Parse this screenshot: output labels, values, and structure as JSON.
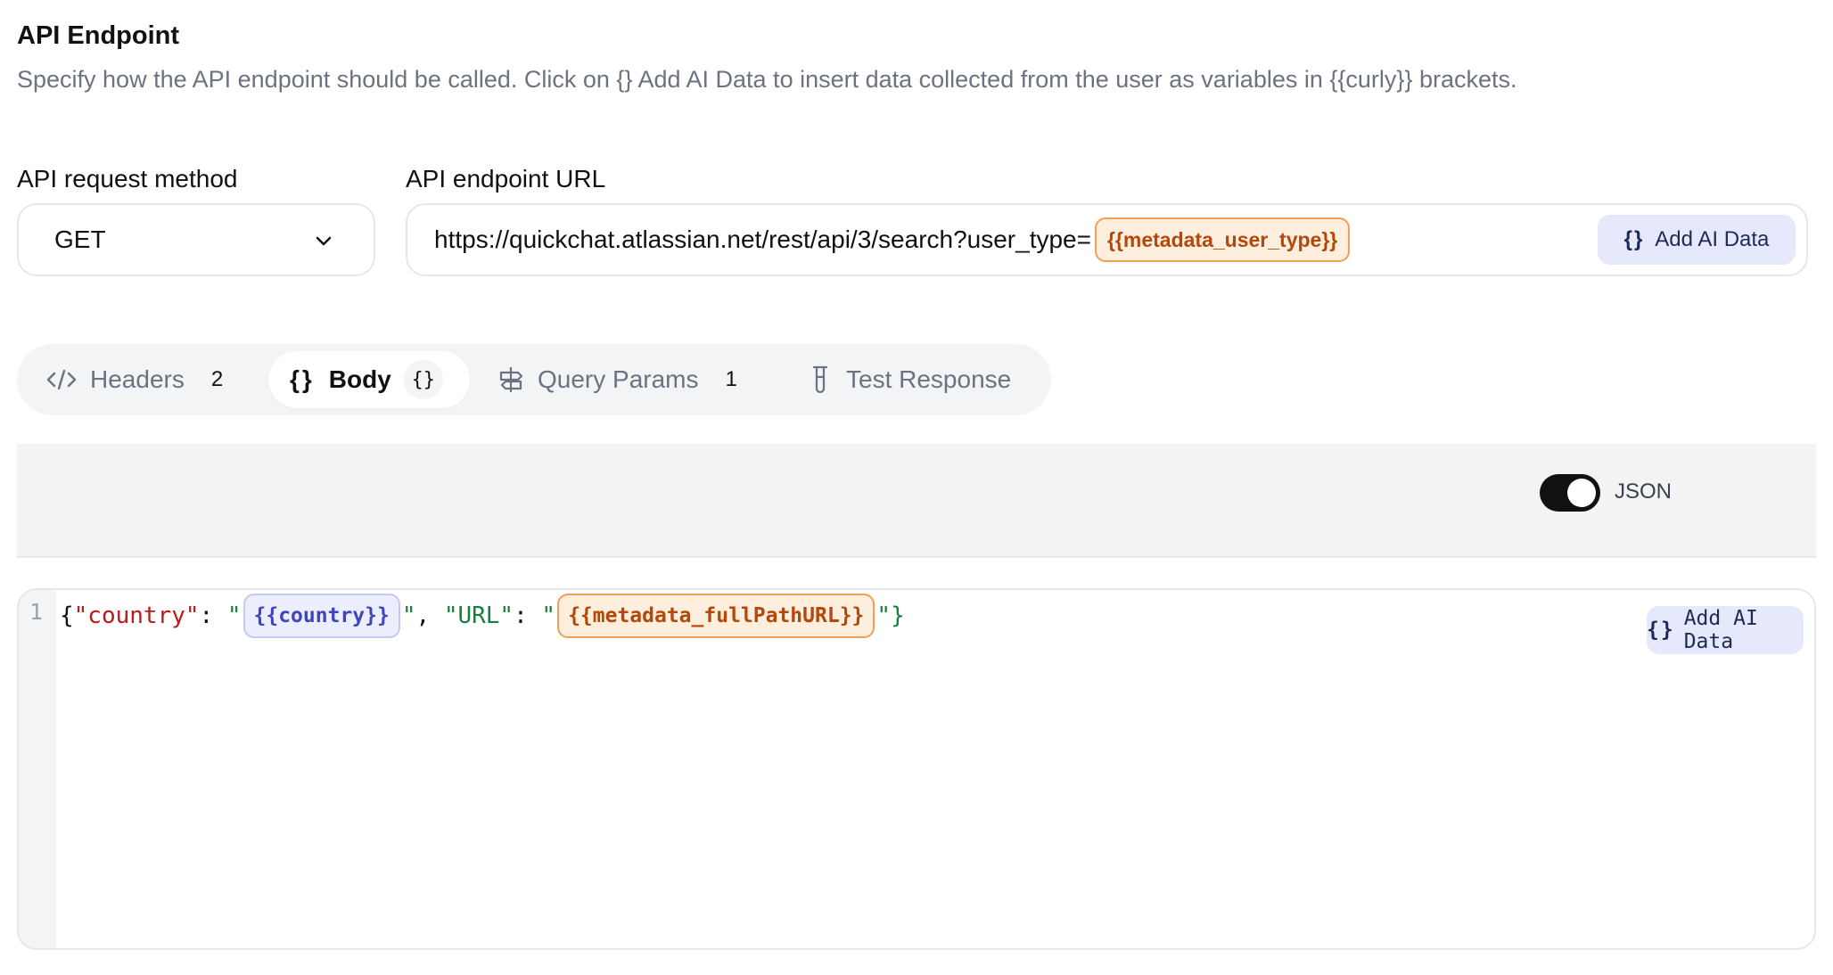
{
  "header": {
    "title": "API Endpoint",
    "description": "Specify how the API endpoint should be called. Click on {} Add AI Data to insert data collected from the user as variables in {{curly}} brackets."
  },
  "method": {
    "label": "API request method",
    "value": "GET"
  },
  "url": {
    "label": "API endpoint URL",
    "value": "https://quickchat.atlassian.net/rest/api/3/search?user_type=",
    "variable": "{{metadata_user_type}}",
    "add_ai_label": "Add AI Data",
    "add_ai_brace": "{}"
  },
  "tabs": [
    {
      "label": "Headers",
      "badge": "2",
      "icon": "code-icon"
    },
    {
      "label": "Body",
      "badge": "{}",
      "icon": "braces-icon",
      "brace": "{}"
    },
    {
      "label": "Query Params",
      "badge": "1",
      "icon": "signpost-icon"
    },
    {
      "label": "Test Response",
      "icon": "test-tube-icon"
    }
  ],
  "body_toolbar": {
    "toggle_label": "JSON",
    "toggle_on": true
  },
  "editor": {
    "line_number": "1",
    "tokens": {
      "open": "{",
      "key1": "\"country\"",
      "colon1": ": ",
      "q1": "\"",
      "var1": "{{country}}",
      "q2": "\"",
      "sep": ", ",
      "key2": "\"URL\"",
      "colon2": ": ",
      "q3": "\"",
      "var2": "{{metadata_fullPathURL}}",
      "q4": "\"",
      "close": "}"
    },
    "add_ai_label": "Add AI Data",
    "add_ai_brace": "{}"
  }
}
